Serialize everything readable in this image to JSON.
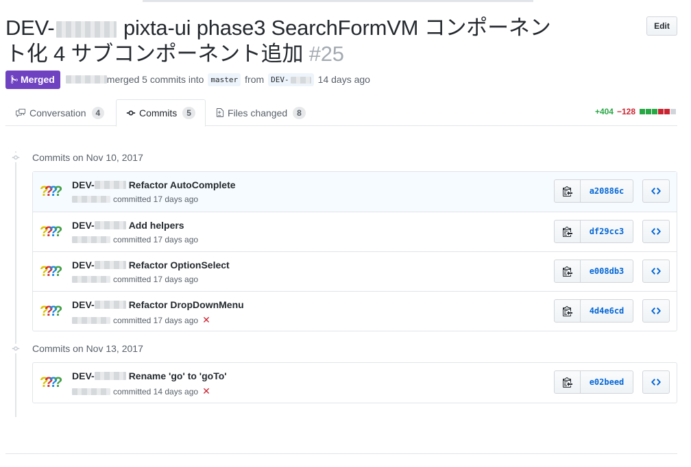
{
  "pr": {
    "title_prefix": "DEV-",
    "title_main": "pixta-ui phase3 SearchFormVM コンポーネント化 4 サブコンポーネント追加",
    "number": "#25",
    "edit_label": "Edit",
    "state_label": "Merged",
    "merged_text": "merged 5 commits into",
    "base_branch": "master",
    "from_text": "from",
    "head_branch_prefix": "DEV-",
    "time_ago": "14 days ago"
  },
  "tabs": [
    {
      "label": "Conversation",
      "count": "4",
      "icon": "comment-discussion-icon"
    },
    {
      "label": "Commits",
      "count": "5",
      "icon": "git-commit-icon"
    },
    {
      "label": "Files changed",
      "count": "8",
      "icon": "file-diff-icon"
    }
  ],
  "diffstat": {
    "additions": "+404",
    "deletions": "−128",
    "colors": [
      "#28a745",
      "#28a745",
      "#28a745",
      "#cb2431",
      "#cb2431",
      "#d1d5da"
    ]
  },
  "commit_groups": [
    {
      "date_label": "Commits on Nov 10, 2017",
      "commits": [
        {
          "prefix": "DEV-",
          "message": "Refactor AutoComplete",
          "meta": "committed 17 days ago",
          "sha": "a20886c",
          "failed": false
        },
        {
          "prefix": "DEV-",
          "message": "Add helpers",
          "meta": "committed 17 days ago",
          "sha": "df29cc3",
          "failed": false
        },
        {
          "prefix": "DEV-",
          "message": "Refactor OptionSelect",
          "meta": "committed 17 days ago",
          "sha": "e008db3",
          "failed": false
        },
        {
          "prefix": "DEV-",
          "message": "Refactor DropDownMenu",
          "meta": "committed 17 days ago",
          "sha": "4d4e6cd",
          "failed": true
        }
      ]
    },
    {
      "date_label": "Commits on Nov 13, 2017",
      "commits": [
        {
          "prefix": "DEV-",
          "message": "Rename 'go' to 'goTo'",
          "meta": "committed 14 days ago",
          "sha": "e02beed",
          "failed": true
        }
      ]
    }
  ],
  "icons": {
    "status_failed": "✕",
    "avatar_glyphs": [
      "?",
      "?",
      "?",
      "?"
    ]
  },
  "colors": {
    "merged": "#6f42c1",
    "link": "#0366d6",
    "add": "#28a745",
    "del": "#cb2431"
  }
}
